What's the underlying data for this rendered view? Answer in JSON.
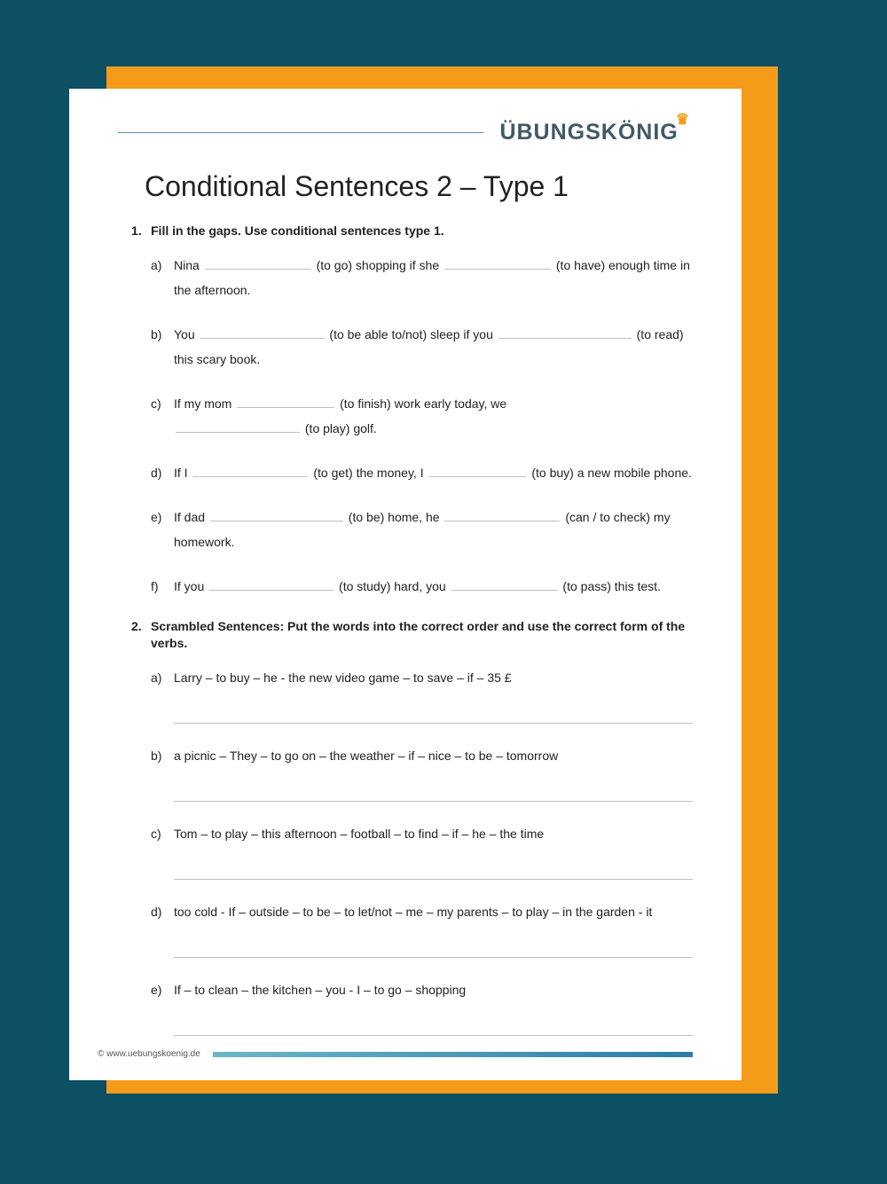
{
  "brand": "ÜBUNGSKÖNIG",
  "title": "Conditional Sentences 2 – Type 1",
  "footer": "© www.uebungskoenig.de",
  "tasks": [
    {
      "num": "1.",
      "head": "Fill in the gaps. Use conditional sentences type 1.",
      "items": [
        {
          "letter": "a)",
          "segments": [
            {
              "t": "Nina "
            },
            {
              "gap": 120
            },
            {
              "t": " (to go) shopping if she "
            },
            {
              "gap": 120
            },
            {
              "t": " (to have) enough time in the afternoon."
            }
          ]
        },
        {
          "letter": "b)",
          "segments": [
            {
              "t": "You "
            },
            {
              "gap": 140
            },
            {
              "t": " (to be able to/not) sleep if you "
            },
            {
              "gap": 150
            },
            {
              "t": " (to read) this scary book."
            }
          ]
        },
        {
          "letter": "c)",
          "segments": [
            {
              "t": "If my mom "
            },
            {
              "gap": 110
            },
            {
              "t": " (to finish) work early today, we "
            },
            {
              "br": true
            },
            {
              "gap": 140
            },
            {
              "t": " (to play) golf."
            }
          ]
        },
        {
          "letter": "d)",
          "segments": [
            {
              "t": "If I "
            },
            {
              "gap": 130
            },
            {
              "t": " (to get) the money, I "
            },
            {
              "gap": 110
            },
            {
              "t": " (to buy) a new mobile phone."
            }
          ]
        },
        {
          "letter": "e)",
          "segments": [
            {
              "t": "If dad "
            },
            {
              "gap": 150
            },
            {
              "t": " (to be) home, he "
            },
            {
              "gap": 130
            },
            {
              "t": " (can / to check) my homework."
            }
          ]
        },
        {
          "letter": "f)",
          "segments": [
            {
              "t": "If you "
            },
            {
              "gap": 140
            },
            {
              "t": " (to study) hard, you "
            },
            {
              "gap": 120
            },
            {
              "t": " (to pass) this test."
            }
          ]
        }
      ]
    },
    {
      "num": "2.",
      "head": "Scrambled Sentences: Put the words into the correct order and use the correct form of the verbs.",
      "items": [
        {
          "letter": "a)",
          "text": "Larry – to buy – he - the new video game – to save – if – 35 £",
          "answerLine": true
        },
        {
          "letter": "b)",
          "text": "a picnic – They – to go on – the weather – if – nice – to be – tomorrow",
          "answerLine": true
        },
        {
          "letter": "c)",
          "text": "Tom – to play – this afternoon – football – to find – if – he – the time",
          "answerLine": true
        },
        {
          "letter": "d)",
          "text": "too cold - If – outside – to be – to let/not – me – my parents – to play – in the garden - it",
          "answerLine": true
        },
        {
          "letter": "e)",
          "text": "If – to clean – the kitchen – you - I – to go – shopping",
          "answerLine": true
        }
      ]
    }
  ]
}
